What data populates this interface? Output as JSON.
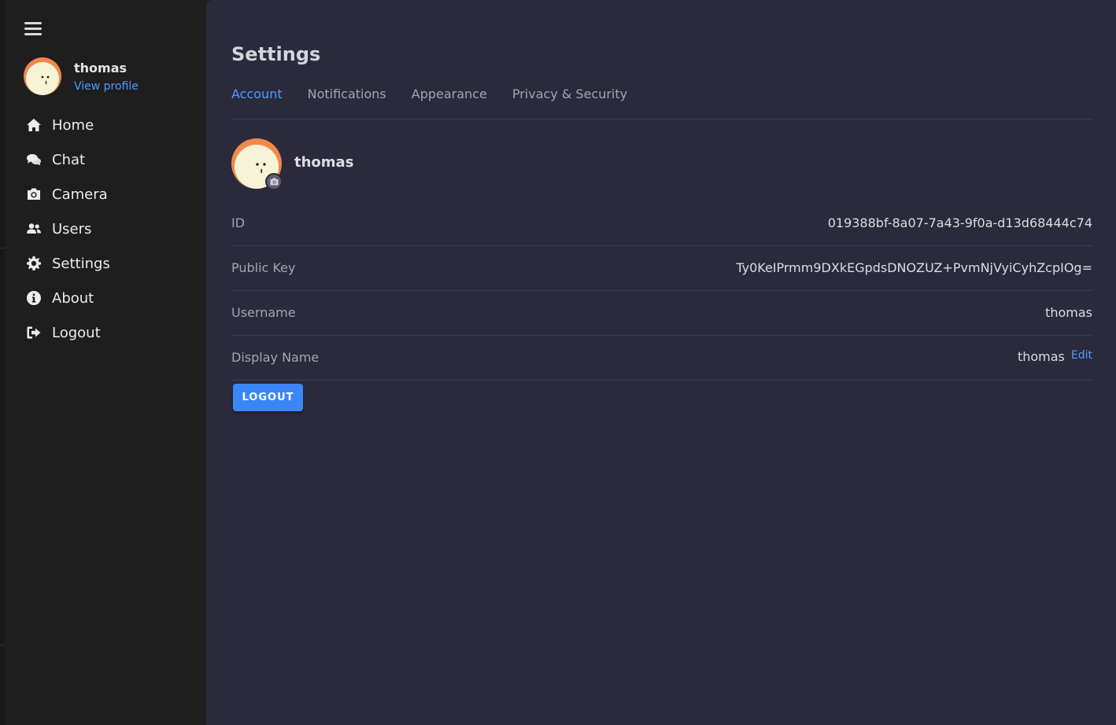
{
  "sidebar": {
    "menu_icon": "hamburger-menu-icon",
    "profile": {
      "name": "thomas",
      "link": "View profile"
    },
    "nav": [
      {
        "label": "Home",
        "icon": "home-icon"
      },
      {
        "label": "Chat",
        "icon": "chat-icon"
      },
      {
        "label": "Camera",
        "icon": "camera-icon"
      },
      {
        "label": "Users",
        "icon": "users-icon"
      },
      {
        "label": "Settings",
        "icon": "gear-icon"
      },
      {
        "label": "About",
        "icon": "info-icon"
      },
      {
        "label": "Logout",
        "icon": "logout-icon"
      }
    ]
  },
  "main": {
    "title": "Settings",
    "tabs": [
      {
        "label": "Account",
        "active": true
      },
      {
        "label": "Notifications",
        "active": false
      },
      {
        "label": "Appearance",
        "active": false
      },
      {
        "label": "Privacy & Security",
        "active": false
      }
    ],
    "account": {
      "name": "thomas",
      "fields": [
        {
          "label": "ID",
          "value": "019388bf-8a07-7a43-9f0a-d13d68444c74"
        },
        {
          "label": "Public Key",
          "value": "Ty0KeIPrmm9DXkEGpdsDNOZUZ+PvmNjVyiCyhZcpIOg="
        },
        {
          "label": "Username",
          "value": "thomas"
        },
        {
          "label": "Display Name",
          "value": "thomas",
          "action": "Edit"
        }
      ],
      "logout_label": "LOGOUT"
    }
  },
  "colors": {
    "accent": "#4e9bff",
    "button": "#3b86f7",
    "sidebar_bg": "#1e1e1e",
    "main_bg": "#2b2a3c",
    "avatar_ring": "#f2884a",
    "avatar_face": "#f7f3d6"
  }
}
